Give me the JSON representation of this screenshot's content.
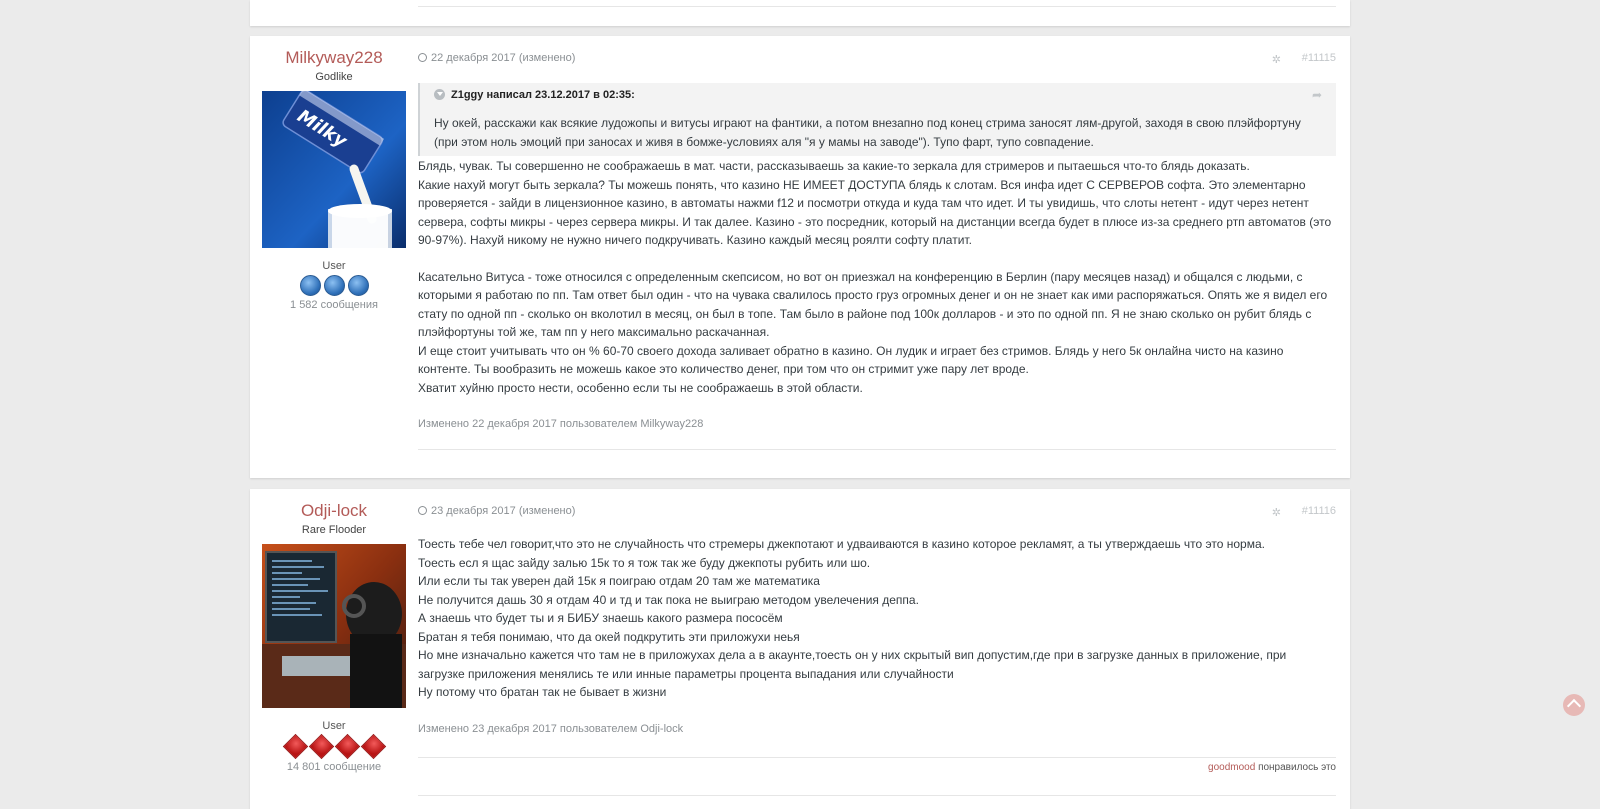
{
  "posts": [
    {
      "author": "Milkyway228",
      "rank_title": "Godlike",
      "group": "User",
      "badge_icon": "blue-round-badge-icon",
      "message_count": "1 582 сообщения",
      "date": "22 декабря 2017 (изменено)",
      "post_number": "#11115",
      "quote": {
        "header": "Z1ggy написал 23.12.2017 в 02:35:",
        "text": "Ну окей, расскажи как всякие лудожопы и витусы играют на фантики, а потом внезапно под конец стрима заносят лям-другой, заходя в свою плэйфортуну (при этом ноль эмоций при заносах и живя в бомже-условиях аля \"я у мамы на заводе\"). Тупо фарт, тупо совпадение."
      },
      "paragraphs": [
        "Блядь, чувак. Ты совершенно не соображаешь в мат. части, рассказываешь за какие-то зеркала для стримеров и пытаешься что-то блядь доказать.",
        "Какие нахуй могут быть зеркала? Ты можешь понять, что казино НЕ ИМЕЕТ ДОСТУПА блядь к слотам. Вся инфа идет С СЕРВЕРОВ софта. Это элементарно проверяется - зайди в лицензионное казино, в автоматы нажми f12 и посмотри откуда и куда там что идет. И ты увидишь, что слоты нетент - идут через нетент сервера, софты микры - через сервера микры. И так далее. Казино - это посредник, который на дистанции всегда будет в плюсе из-за среднего ртп автоматов (это 90-97%). Нахуй никому не нужно ничего подкручивать. Казино каждый месяц роялти софту платит.",
        "",
        "Касательно Витуса - тоже относился с определенным скепсисом, но вот он приезжал на конференцию в Берлин (пару месяцев назад) и общался с людьми, с которыми я работаю по пп. Там ответ был один - что на чувака свалилось просто груз огромных денег и он не знает как ими распоряжаться. Опять же я видел его стату по одной пп - сколько он вколотил в месяц, он был в топе. Там было в районе под 100к долларов - и это по одной пп. Я не знаю сколько он рубит блядь с плэйфортуны той же, там пп у него максимально раскачанная.",
        "И еще стоит учитывать что он % 60-70 своего дохода заливает обратно в казино. Он лудик и играет без стримов. Блядь у него 5к онлайна чисто на казино контенте. Ты вообразить не можешь какое это количество денег, при том что он стримит уже пару лет вроде.",
        "Хватит хуйню просто нести, особенно если ты не соображаешь в этой области."
      ],
      "edited_note": "Изменено 22 декабря 2017 пользователем Milkyway228"
    },
    {
      "author": "Odji-lock",
      "rank_title": "Rare Flooder",
      "group": "User",
      "badge_icon": "red-diamond-badge-icon",
      "message_count": "14 801 сообщение",
      "date": "23 декабря 2017 (изменено)",
      "post_number": "#11116",
      "paragraphs": [
        "Тоесть тебе чел говорит,что это не случайность что стремеры джекпотают и удваиваются в казино которое рекламят, а ты утверждаешь что это норма.",
        "Тоесть есл я щас зайду залью 15к то я тож так же буду джекпоты рубить или шо.",
        "Или если ты так уверен дай 15к я поиграю отдам 20 там же математика",
        "Не получится дашь 30 я отдам 40 и тд и так пока не выиграю методом увелечения деппа.",
        "А знаешь что будет ты и я БИБУ знаешь какого размера пососём",
        "Братан я тебя понимаю, что да окей подкрутить эти приложухи неья",
        "Но мне изначально кажется что там не в приложухах дела а в акаунте,тоесть он у них скрытый вип допустим,где при в загрузке данных в приложение, при загрузке приложения менялись те или инные параметры процента выпадания или случайности",
        "Ну потому что братан так не бывает в жизни"
      ],
      "edited_note": "Изменено 23 декабря 2017 пользователем Odji-lock",
      "reaction": {
        "user": "goodmood",
        "text": "понравилось это"
      }
    }
  ],
  "icons": {
    "clock": "clock-icon",
    "share": "share-icon",
    "quote_toggle": "chevron-down-icon",
    "quote_jump": "share-arrow-icon",
    "scroll_top": "chevron-up-icon"
  },
  "colors": {
    "author": "#b35b58",
    "page_bg": "#ebebeb",
    "muted": "#8a8f93"
  }
}
